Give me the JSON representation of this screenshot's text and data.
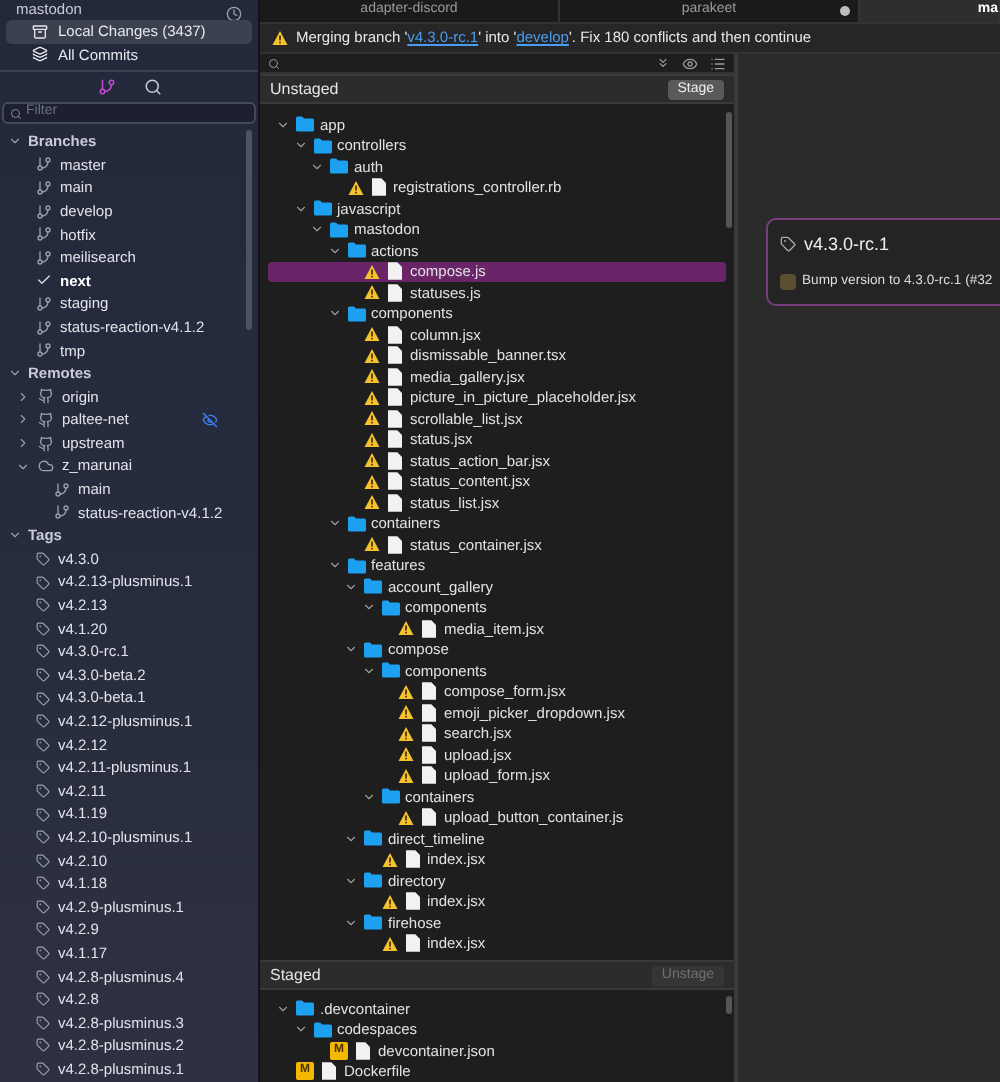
{
  "sidebar": {
    "repo": "mastodon",
    "views": [
      {
        "label": "Local Changes (3437)",
        "kind": "changes",
        "selected": true
      },
      {
        "label": "All Commits",
        "kind": "commits",
        "selected": false
      }
    ],
    "modes": [
      {
        "kind": "branches",
        "selected": true
      },
      {
        "kind": "search",
        "selected": false
      }
    ],
    "filter": {
      "placeholder": "Filter"
    },
    "sections": [
      {
        "title": "Branches",
        "expanded": true,
        "items": [
          {
            "label": "master",
            "kind": "branch",
            "current": false
          },
          {
            "label": "main",
            "kind": "branch",
            "current": false
          },
          {
            "label": "develop",
            "kind": "branch",
            "current": false
          },
          {
            "label": "hotfix",
            "kind": "branch",
            "current": false
          },
          {
            "label": "meilisearch",
            "kind": "branch",
            "current": false
          },
          {
            "label": "next",
            "kind": "branch",
            "current": true
          },
          {
            "label": "staging",
            "kind": "branch",
            "current": false
          },
          {
            "label": "status-reaction-v4.1.2",
            "kind": "branch",
            "current": false
          },
          {
            "label": "tmp",
            "kind": "branch",
            "current": false
          }
        ]
      },
      {
        "title": "Remotes",
        "expanded": true,
        "items": [
          {
            "label": "origin",
            "kind": "github-remote",
            "expanded": false,
            "hidden": false
          },
          {
            "label": "paltee-net",
            "kind": "github-remote",
            "expanded": false,
            "hidden": true
          },
          {
            "label": "upstream",
            "kind": "github-remote",
            "expanded": false,
            "hidden": false
          },
          {
            "label": "z_marunai",
            "kind": "remote",
            "expanded": true,
            "hidden": false,
            "children": [
              {
                "label": "main",
                "kind": "branch",
                "current": false
              },
              {
                "label": "status-reaction-v4.1.2",
                "kind": "branch",
                "current": false
              }
            ]
          }
        ]
      },
      {
        "title": "Tags",
        "expanded": true,
        "items": [
          {
            "label": "v4.3.0",
            "kind": "tag"
          },
          {
            "label": "v4.2.13-plusminus.1",
            "kind": "tag"
          },
          {
            "label": "v4.2.13",
            "kind": "tag"
          },
          {
            "label": "v4.1.20",
            "kind": "tag"
          },
          {
            "label": "v4.3.0-rc.1",
            "kind": "tag"
          },
          {
            "label": "v4.3.0-beta.2",
            "kind": "tag"
          },
          {
            "label": "v4.3.0-beta.1",
            "kind": "tag"
          },
          {
            "label": "v4.2.12-plusminus.1",
            "kind": "tag"
          },
          {
            "label": "v4.2.12",
            "kind": "tag"
          },
          {
            "label": "v4.2.11-plusminus.1",
            "kind": "tag"
          },
          {
            "label": "v4.2.11",
            "kind": "tag"
          },
          {
            "label": "v4.1.19",
            "kind": "tag"
          },
          {
            "label": "v4.2.10-plusminus.1",
            "kind": "tag"
          },
          {
            "label": "v4.2.10",
            "kind": "tag"
          },
          {
            "label": "v4.1.18",
            "kind": "tag"
          },
          {
            "label": "v4.2.9-plusminus.1",
            "kind": "tag"
          },
          {
            "label": "v4.2.9",
            "kind": "tag"
          },
          {
            "label": "v4.1.17",
            "kind": "tag"
          },
          {
            "label": "v4.2.8-plusminus.4",
            "kind": "tag"
          },
          {
            "label": "v4.2.8",
            "kind": "tag"
          },
          {
            "label": "v4.2.8-plusminus.3",
            "kind": "tag"
          },
          {
            "label": "v4.2.8-plusminus.2",
            "kind": "tag"
          },
          {
            "label": "v4.2.8-plusminus.1",
            "kind": "tag"
          }
        ]
      }
    ]
  },
  "tabs": [
    {
      "label": "adapter-discord",
      "selected": false,
      "unsaved": false
    },
    {
      "label": "parakeet",
      "selected": false,
      "unsaved": true
    },
    {
      "label": "ma",
      "selected": true,
      "unsaved": false
    }
  ],
  "banner": {
    "parts": [
      {
        "kind": "text",
        "text": "Merging branch '"
      },
      {
        "kind": "link",
        "text": "v4.3.0-rc.1"
      },
      {
        "kind": "text",
        "text": "' into '"
      },
      {
        "kind": "link",
        "text": "develop"
      },
      {
        "kind": "text",
        "text": "'. Fix 180 conflicts and then continue"
      }
    ]
  },
  "unstaged": {
    "title": "Unstaged",
    "action": "Stage",
    "action_disabled": false,
    "tree": [
      {
        "kind": "folder",
        "name": "app",
        "expanded": true,
        "selected": false,
        "children": [
          {
            "kind": "folder",
            "name": "controllers",
            "expanded": true,
            "selected": false,
            "children": [
              {
                "kind": "folder",
                "name": "auth",
                "expanded": true,
                "selected": false,
                "children": [
                  {
                    "kind": "file",
                    "name": "registrations_controller.rb",
                    "conflict": true,
                    "selected": false
                  }
                ]
              }
            ]
          },
          {
            "kind": "folder",
            "name": "javascript",
            "expanded": true,
            "selected": false,
            "children": [
              {
                "kind": "folder",
                "name": "mastodon",
                "expanded": true,
                "selected": false,
                "children": [
                  {
                    "kind": "folder",
                    "name": "actions",
                    "expanded": true,
                    "selected": false,
                    "children": [
                      {
                        "kind": "file",
                        "name": "compose.js",
                        "conflict": true,
                        "selected": true
                      },
                      {
                        "kind": "file",
                        "name": "statuses.js",
                        "conflict": true,
                        "selected": false
                      }
                    ]
                  },
                  {
                    "kind": "folder",
                    "name": "components",
                    "expanded": true,
                    "selected": false,
                    "children": [
                      {
                        "kind": "file",
                        "name": "column.jsx",
                        "conflict": true,
                        "selected": false
                      },
                      {
                        "kind": "file",
                        "name": "dismissable_banner.tsx",
                        "conflict": true,
                        "selected": false
                      },
                      {
                        "kind": "file",
                        "name": "media_gallery.jsx",
                        "conflict": true,
                        "selected": false
                      },
                      {
                        "kind": "file",
                        "name": "picture_in_picture_placeholder.jsx",
                        "conflict": true,
                        "selected": false
                      },
                      {
                        "kind": "file",
                        "name": "scrollable_list.jsx",
                        "conflict": true,
                        "selected": false
                      },
                      {
                        "kind": "file",
                        "name": "status.jsx",
                        "conflict": true,
                        "selected": false
                      },
                      {
                        "kind": "file",
                        "name": "status_action_bar.jsx",
                        "conflict": true,
                        "selected": false
                      },
                      {
                        "kind": "file",
                        "name": "status_content.jsx",
                        "conflict": true,
                        "selected": false
                      },
                      {
                        "kind": "file",
                        "name": "status_list.jsx",
                        "conflict": true,
                        "selected": false
                      }
                    ]
                  },
                  {
                    "kind": "folder",
                    "name": "containers",
                    "expanded": true,
                    "selected": false,
                    "children": [
                      {
                        "kind": "file",
                        "name": "status_container.jsx",
                        "conflict": true,
                        "selected": false
                      }
                    ]
                  },
                  {
                    "kind": "folder",
                    "name": "features",
                    "expanded": true,
                    "selected": false,
                    "children": [
                      {
                        "kind": "folder",
                        "name": "account_gallery",
                        "expanded": true,
                        "selected": false,
                        "children": [
                          {
                            "kind": "folder",
                            "name": "components",
                            "expanded": true,
                            "selected": false,
                            "children": [
                              {
                                "kind": "file",
                                "name": "media_item.jsx",
                                "conflict": true,
                                "selected": false
                              }
                            ]
                          }
                        ]
                      },
                      {
                        "kind": "folder",
                        "name": "compose",
                        "expanded": true,
                        "selected": false,
                        "children": [
                          {
                            "kind": "folder",
                            "name": "components",
                            "expanded": true,
                            "selected": false,
                            "children": [
                              {
                                "kind": "file",
                                "name": "compose_form.jsx",
                                "conflict": true,
                                "selected": false
                              },
                              {
                                "kind": "file",
                                "name": "emoji_picker_dropdown.jsx",
                                "conflict": true,
                                "selected": false
                              },
                              {
                                "kind": "file",
                                "name": "search.jsx",
                                "conflict": true,
                                "selected": false
                              },
                              {
                                "kind": "file",
                                "name": "upload.jsx",
                                "conflict": true,
                                "selected": false
                              },
                              {
                                "kind": "file",
                                "name": "upload_form.jsx",
                                "conflict": true,
                                "selected": false
                              }
                            ]
                          },
                          {
                            "kind": "folder",
                            "name": "containers",
                            "expanded": true,
                            "selected": false,
                            "children": [
                              {
                                "kind": "file",
                                "name": "upload_button_container.js",
                                "conflict": true,
                                "selected": false
                              }
                            ]
                          }
                        ]
                      },
                      {
                        "kind": "folder",
                        "name": "direct_timeline",
                        "expanded": true,
                        "selected": false,
                        "children": [
                          {
                            "kind": "file",
                            "name": "index.jsx",
                            "conflict": true,
                            "selected": false
                          }
                        ]
                      },
                      {
                        "kind": "folder",
                        "name": "directory",
                        "expanded": true,
                        "selected": false,
                        "children": [
                          {
                            "kind": "file",
                            "name": "index.jsx",
                            "conflict": true,
                            "selected": false
                          }
                        ]
                      },
                      {
                        "kind": "folder",
                        "name": "firehose",
                        "expanded": true,
                        "selected": false,
                        "children": [
                          {
                            "kind": "file",
                            "name": "index.jsx",
                            "conflict": true,
                            "selected": false
                          }
                        ]
                      }
                    ]
                  }
                ]
              }
            ]
          }
        ]
      }
    ]
  },
  "staged": {
    "title": "Staged",
    "action": "Unstage",
    "action_disabled": true,
    "tree": [
      {
        "kind": "folder",
        "name": ".devcontainer",
        "expanded": true,
        "selected": false,
        "children": [
          {
            "kind": "folder",
            "name": "codespaces",
            "expanded": true,
            "selected": false,
            "children": [
              {
                "kind": "file",
                "name": "devcontainer.json",
                "conflict": false,
                "badge": "M",
                "selected": false
              }
            ]
          }
        ]
      },
      {
        "kind": "file",
        "name": "Dockerfile",
        "conflict": false,
        "badge": "M",
        "selected": false
      }
    ]
  },
  "detail": {
    "tag": "v4.3.0-rc.1",
    "message": "Bump version to 4.3.0-rc.1 (#32"
  }
}
